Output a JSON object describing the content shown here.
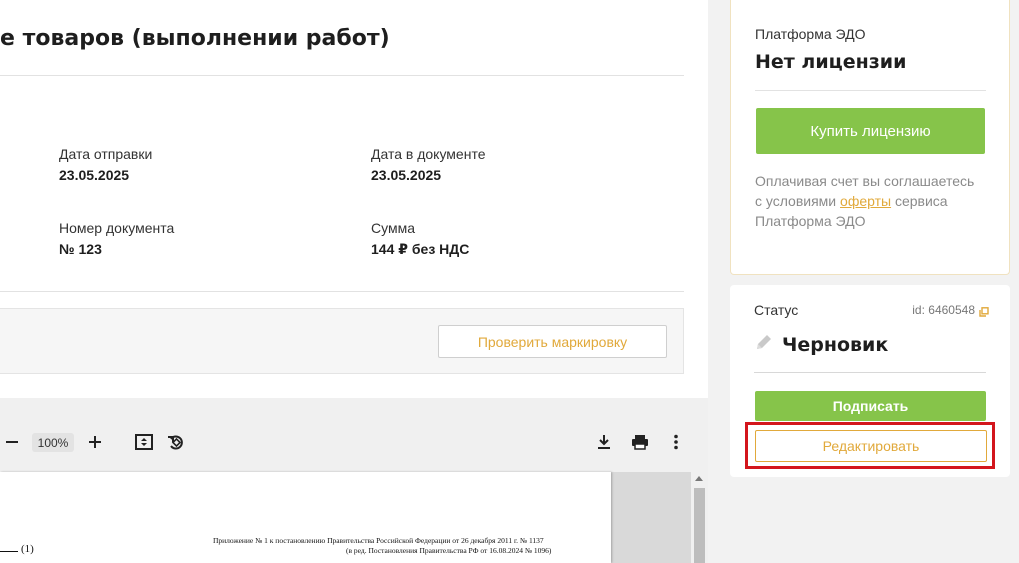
{
  "document": {
    "title": "е товаров (выполнении работ)",
    "fields": [
      {
        "label": "Дата отправки",
        "value": "23.05.2025"
      },
      {
        "label": "Дата в документе",
        "value": "23.05.2025"
      },
      {
        "label": "Номер документа",
        "value": "№ 123"
      },
      {
        "label": "Сумма",
        "value": "144 ₽ без НДС"
      }
    ],
    "check_marking_label": "Проверить маркировку"
  },
  "viewer": {
    "zoom": "100%",
    "icons": [
      "zoom-out-icon",
      "zoom-in-icon",
      "fit-page-icon",
      "rotate-icon",
      "download-icon",
      "print-icon",
      "more-vertical-icon"
    ],
    "page_text": {
      "mark": "(1)",
      "annex_line1": "Приложение № 1 к постановлению Правительства Российской Федерации от 26 декабря 2011 г. № 1137",
      "annex_line2": "(в ред. Постановления Правительства РФ от 16.08.2024 № 1096)"
    }
  },
  "license": {
    "platform": "Платформа ЭДО",
    "status": "Нет лицензии",
    "buy_label": "Купить лицензию",
    "note_before": "Оплачивая счет вы соглашаетесь с условиями ",
    "offer_link": "оферты",
    "note_after": " сервиса Платформа ЭДО"
  },
  "status": {
    "label": "Статус",
    "id": "id: 6460548",
    "name": "Черновик",
    "sign_label": "Подписать",
    "edit_label": "Редактировать"
  },
  "colors": {
    "accent_green": "#86c44a",
    "accent_orange": "#e1a93b",
    "highlight_red": "#d3161c"
  }
}
